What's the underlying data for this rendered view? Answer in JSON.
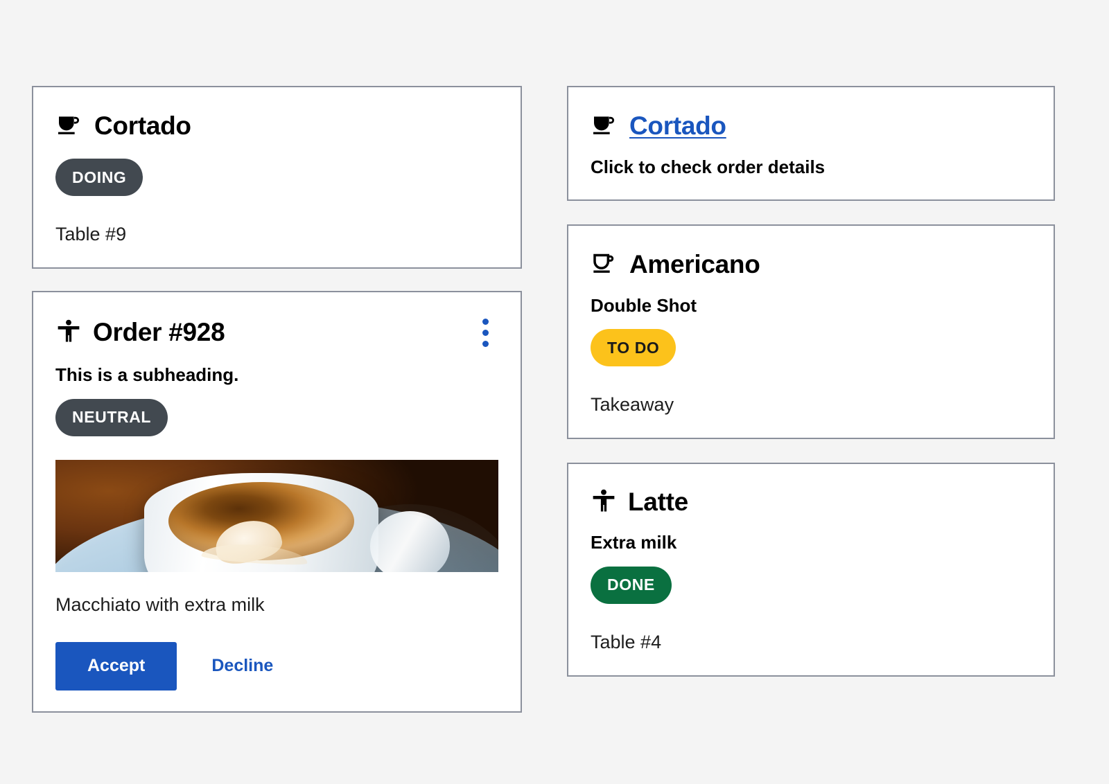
{
  "theme": {
    "page_background": "#f4f4f4",
    "card_background": "#ffffff",
    "card_border": "#8b909c",
    "accent_blue": "#1a56be",
    "badge_neutral": "#424950",
    "badge_todo": "#fcc21b",
    "badge_done": "#0a7040"
  },
  "left_column": {
    "cortado_card": {
      "icon": "coffee-cup-filled-icon",
      "title": "Cortado",
      "badge": {
        "label": "DOING",
        "color": "#424950"
      },
      "detail": "Table #9"
    },
    "order_card": {
      "icon": "accessibility-person-icon",
      "title": "Order #928",
      "menu_icon": "kebab-menu-icon",
      "subheading": "This is a subheading.",
      "badge": {
        "label": "NEUTRAL",
        "color": "#424950"
      },
      "media_alt": "coffee-cup-photo",
      "description": "Macchiato with extra milk",
      "primary_action": "Accept",
      "secondary_action": "Decline"
    }
  },
  "right_column": {
    "cortado_link_card": {
      "icon": "coffee-cup-filled-icon",
      "title": "Cortado",
      "hint": "Click to check order details"
    },
    "americano_card": {
      "icon": "coffee-cup-outline-icon",
      "title": "Americano",
      "subheading": "Double Shot",
      "badge": {
        "label": "TO DO",
        "color": "#fcc21b"
      },
      "detail": "Takeaway"
    },
    "latte_card": {
      "icon": "accessibility-person-icon",
      "title": "Latte",
      "subheading": "Extra milk",
      "badge": {
        "label": "DONE",
        "color": "#0a7040"
      },
      "detail": "Table #4"
    }
  }
}
